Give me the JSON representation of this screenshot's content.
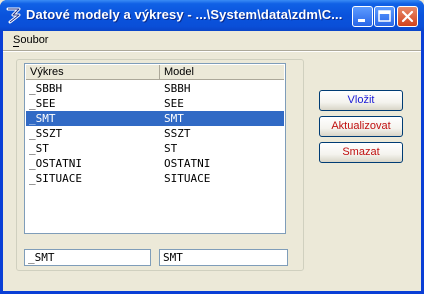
{
  "window": {
    "title": "Datové modely a výkresy - ...\\System\\data\\zdm\\C...",
    "app_icon": "app-logo-icon"
  },
  "titlebar_buttons": [
    "minimize-icon",
    "maximize-icon",
    "close-icon"
  ],
  "menu": {
    "items": [
      {
        "label": "Soubor"
      }
    ]
  },
  "list": {
    "columns": [
      "Výkres",
      "Model"
    ],
    "rows": [
      {
        "vykres": "_SBBH",
        "model": "SBBH"
      },
      {
        "vykres": "_SEE",
        "model": "SEE"
      },
      {
        "vykres": "_SMT",
        "model": "SMT"
      },
      {
        "vykres": "_SSZT",
        "model": "SSZT"
      },
      {
        "vykres": "_ST",
        "model": "ST"
      },
      {
        "vykres": "_OSTATNI",
        "model": "OSTATNI"
      },
      {
        "vykres": "_SITUACE",
        "model": "SITUACE"
      }
    ],
    "selected_index": 2
  },
  "fields": {
    "vykres_value": "_SMT",
    "model_value": "SMT"
  },
  "buttons": {
    "insert": "Vložit",
    "update": "Aktualizovat",
    "delete": "Smazat"
  },
  "colors": {
    "titlebar": "#0a53dc",
    "selection": "#316ac5",
    "insert_text": "#1b1bd6",
    "danger_text": "#c01010"
  }
}
